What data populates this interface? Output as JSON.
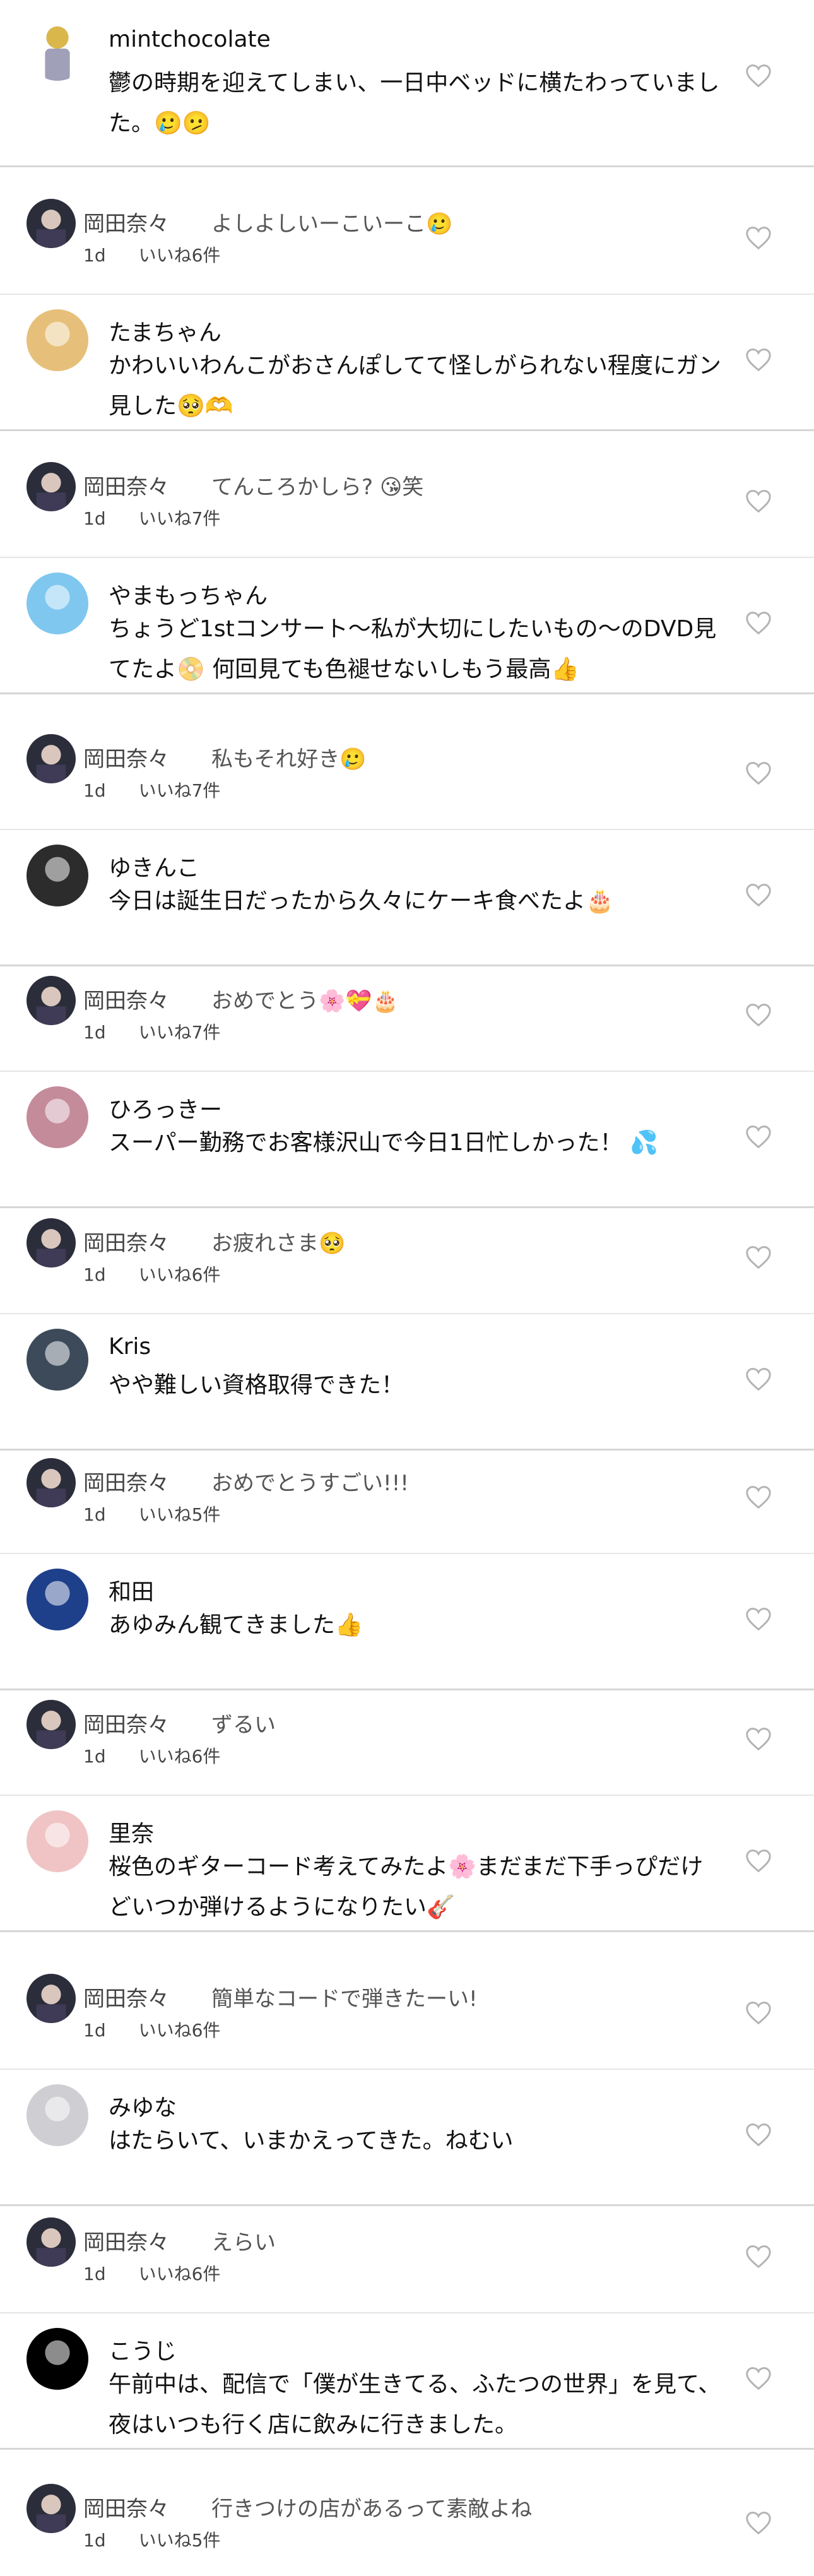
{
  "comments": [
    {
      "name": "mintchocolate",
      "text": "鬱の時期を迎えてしまい、一日中ベッドに横たわっていました。🥲🫤"
    },
    {
      "reply": {
        "name": "岡田奈々",
        "text": "よしよしいーこいーこ🥲",
        "time": "1d",
        "likes": "いいね6件"
      },
      "name": "たまちゃん",
      "text": "かわいいわんこがおさんぽしてて怪しがられない程度にガン見した🥺🫶"
    },
    {
      "reply": {
        "name": "岡田奈々",
        "text": "てんころかしら? 😘笑",
        "time": "1d",
        "likes": "いいね7件"
      },
      "name": "やまもっちゃん",
      "text": "ちょうど1stコンサート〜私が大切にしたいもの〜のDVD見てたよ📀 何回見ても色褪せないしもう最高👍"
    },
    {
      "reply": {
        "name": "岡田奈々",
        "text": "私もそれ好き🥲",
        "time": "1d",
        "likes": "いいね7件"
      },
      "name": "ゆきんこ",
      "text": "今日は誕生日だったから久々にケーキ食べたよ🎂"
    },
    {
      "reply": {
        "name": "岡田奈々",
        "text": "おめでとう🌸💝🎂",
        "time": "1d",
        "likes": "いいね7件"
      },
      "name": "ひろっきー",
      "text": "スーパー勤務でお客様沢山で今日1日忙しかった！ 💦"
    },
    {
      "reply": {
        "name": "岡田奈々",
        "text": "お疲れさま🥺",
        "time": "1d",
        "likes": "いいね6件"
      },
      "name": "Kris",
      "text": "やや難しい資格取得できた！"
    },
    {
      "reply": {
        "name": "岡田奈々",
        "text": "おめでとうすごい!!!",
        "time": "1d",
        "likes": "いいね5件"
      },
      "name": "和田",
      "text": "あゆみん観てきました👍"
    },
    {
      "reply": {
        "name": "岡田奈々",
        "text": "ずるい",
        "time": "1d",
        "likes": "いいね6件"
      },
      "name": "里奈",
      "text": "桜色のギターコード考えてみたよ🌸まだまだ下手っぴだけどいつか弾けるようになりたい🎸"
    },
    {
      "reply": {
        "name": "岡田奈々",
        "text": "簡単なコードで弾きたーい!",
        "time": "1d",
        "likes": "いいね6件"
      },
      "name": "みゆな",
      "text": "はたらいて、いまかえってきた。ねむい"
    },
    {
      "reply": {
        "name": "岡田奈々",
        "text": "えらい",
        "time": "1d",
        "likes": "いいね6件"
      },
      "name": "こうじ",
      "text": "午前中は、配信で「僕が生きてる、ふたつの世界」を見て、夜はいつも行く店に飲みに行きました。"
    },
    {
      "reply": {
        "name": "岡田奈々",
        "text": "行きつけの店があるって素敵よね",
        "time": "1d",
        "likes": "いいね5件"
      }
    }
  ],
  "colors": {
    "separator": "#d6d6d6",
    "heart_outline": "#b3b3b3",
    "reply_text": "#555555"
  },
  "icons": {
    "like": "heart-outline-icon"
  }
}
